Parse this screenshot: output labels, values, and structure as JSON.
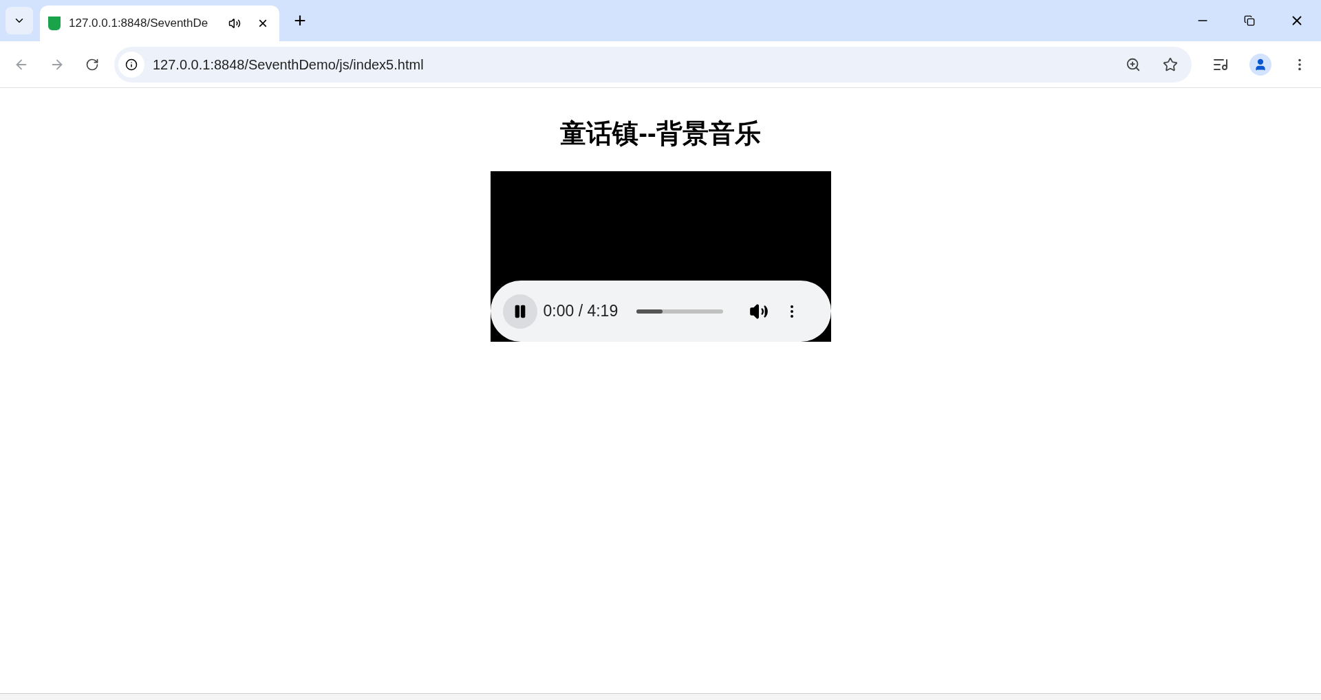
{
  "tabs": [
    {
      "title": "127.0.0.1:8848/SeventhDe",
      "selected": true,
      "audio_playing": true,
      "close": "×"
    }
  ],
  "new_tab": "+",
  "address_bar": {
    "url": "127.0.0.1:8848/SeventhDemo/js/index5.html"
  },
  "page": {
    "heading": "童话镇--背景音乐",
    "player": {
      "playing": true,
      "time": "0:00 / 4:19",
      "level": 0.3
    }
  }
}
